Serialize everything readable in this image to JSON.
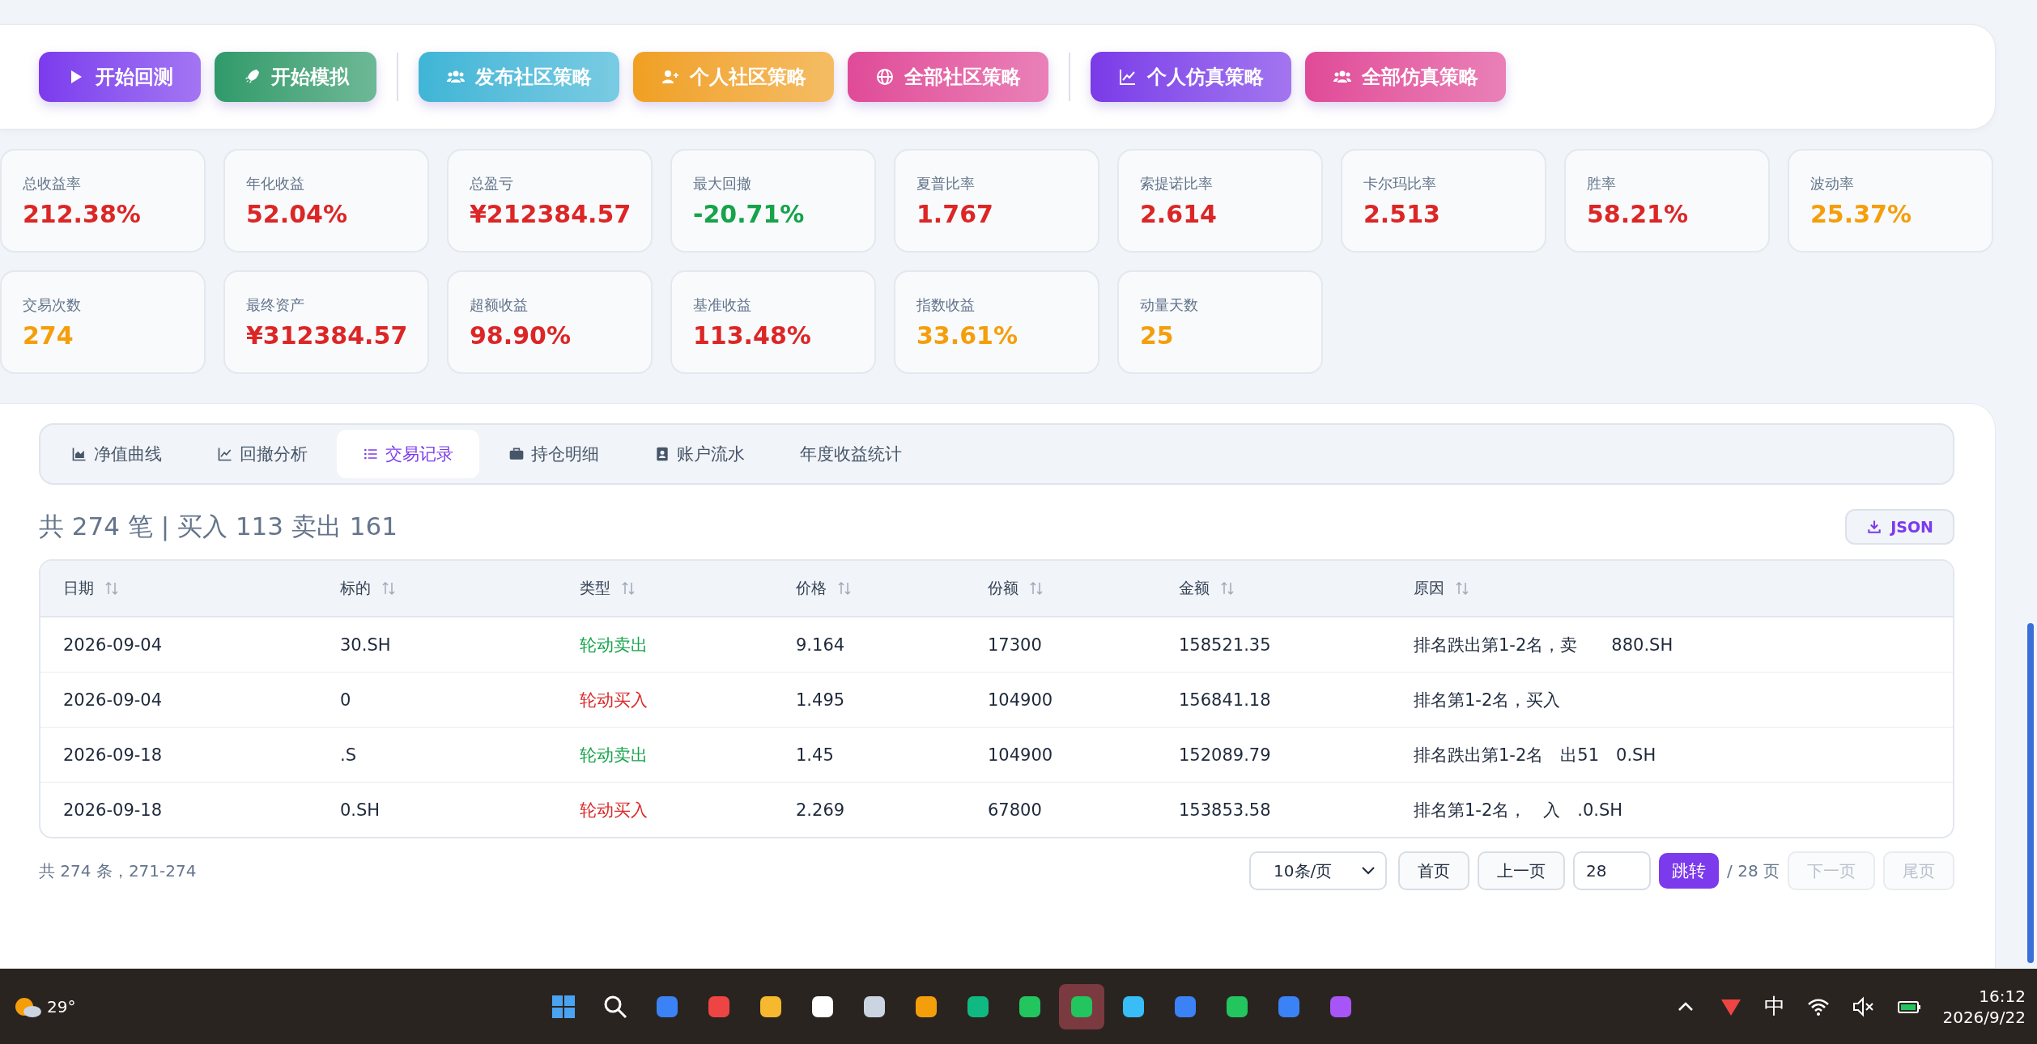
{
  "button_groups": [
    [
      {
        "label": "开始回测",
        "color": "#7c3aed"
      },
      {
        "label": "开始模拟",
        "color": "#2f9a6a"
      }
    ],
    [
      {
        "label": "发布社区策略",
        "color": "#3fb5d6"
      },
      {
        "label": "个人社区策略",
        "color": "#f0a020"
      },
      {
        "label": "全部社区策略",
        "color": "#e04a98"
      }
    ],
    [
      {
        "label": "个人仿真策略",
        "color": "#7b3ae8"
      },
      {
        "label": "全部仿真策略",
        "color": "#e04a98"
      }
    ]
  ],
  "metrics": [
    {
      "label": "总收益率",
      "value": "212.38%",
      "color": "#dc2626"
    },
    {
      "label": "年化收益",
      "value": "52.04%",
      "color": "#dc2626"
    },
    {
      "label": "总盈亏",
      "value": "¥212384.57",
      "color": "#dc2626"
    },
    {
      "label": "最大回撤",
      "value": "-20.71%",
      "color": "#16a34a"
    },
    {
      "label": "夏普比率",
      "value": "1.767",
      "color": "#dc2626"
    },
    {
      "label": "索提诺比率",
      "value": "2.614",
      "color": "#dc2626"
    },
    {
      "label": "卡尔玛比率",
      "value": "2.513",
      "color": "#dc2626"
    },
    {
      "label": "胜率",
      "value": "58.21%",
      "color": "#dc2626"
    },
    {
      "label": "波动率",
      "value": "25.37%",
      "color": "#f59e0b"
    },
    {
      "label": "交易次数",
      "value": "274",
      "color": "#f59e0b"
    },
    {
      "label": "最终资产",
      "value": "¥312384.57",
      "color": "#dc2626"
    },
    {
      "label": "超额收益",
      "value": "98.90%",
      "color": "#dc2626"
    },
    {
      "label": "基准收益",
      "value": "113.48%",
      "color": "#dc2626"
    },
    {
      "label": "指数收益",
      "value": "33.61%",
      "color": "#f59e0b"
    },
    {
      "label": "动量天数",
      "value": "25",
      "color": "#f59e0b"
    }
  ],
  "tabs": [
    {
      "label": "净值曲线",
      "selected": false
    },
    {
      "label": "回撤分析",
      "selected": false
    },
    {
      "label": "交易记录",
      "selected": true
    },
    {
      "label": "持仓明细",
      "selected": false
    },
    {
      "label": "账户流水",
      "selected": false
    },
    {
      "label": "年度收益统计",
      "selected": false
    }
  ],
  "summary": "共 274 笔 | 买入 113 卖出 161",
  "export_button": "JSON",
  "table": {
    "columns": [
      "日期",
      "标的",
      "类型",
      "价格",
      "份额",
      "金额",
      "原因"
    ],
    "rows": [
      {
        "cells": [
          "2026-09-04",
          "30.SH",
          "轮动卖出",
          "9.164",
          "17300",
          "158521.35",
          "排名跌出第1-2名，卖　　880.SH"
        ],
        "color": "#16a34a"
      },
      {
        "cells": [
          "2026-09-04",
          "0",
          "轮动买入",
          "1.495",
          "104900",
          "156841.18",
          "排名第1-2名，买入"
        ],
        "color": "#dc2626"
      },
      {
        "cells": [
          "2026-09-18",
          ".S",
          "轮动卖出",
          "1.45",
          "104900",
          "152089.79",
          "排名跌出第1-2名　出51　0.SH"
        ],
        "color": "#16a34a"
      },
      {
        "cells": [
          "2026-09-18",
          "0.SH",
          "轮动买入",
          "2.269",
          "67800",
          "153853.58",
          "排名第1-2名，　入　.0.SH"
        ],
        "color": "#dc2626"
      }
    ]
  },
  "pagination": {
    "total": "共 274 条，271-274",
    "page_size": "10条/页",
    "first": "首页",
    "prev": "上一页",
    "page_input": "28",
    "go": "跳转",
    "page_count": "/ 28 页",
    "next": {
      "label": "下一页",
      "disabled": true
    },
    "last": {
      "label": "尾页",
      "disabled": true
    }
  },
  "taskbar": {
    "weather": "29°",
    "ime": "中",
    "time": "16:12",
    "date": "2026/9/22"
  }
}
